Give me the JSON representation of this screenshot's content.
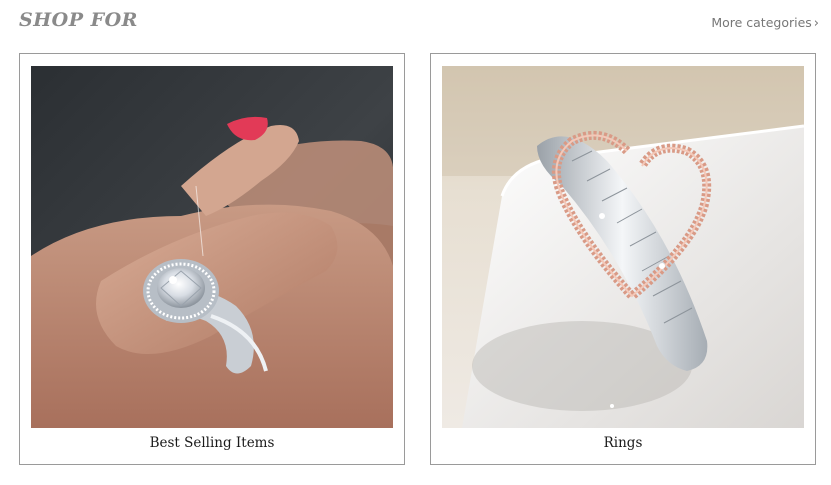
{
  "header": {
    "title": "SHOP FOR",
    "more_label": "More categories",
    "more_chevron": "›"
  },
  "cards": [
    {
      "caption": "Best Selling Items",
      "image": "diamond-halo-ring-on-hand-photo"
    },
    {
      "caption": "Rings",
      "image": "heart-baguette-ring-photo"
    }
  ]
}
